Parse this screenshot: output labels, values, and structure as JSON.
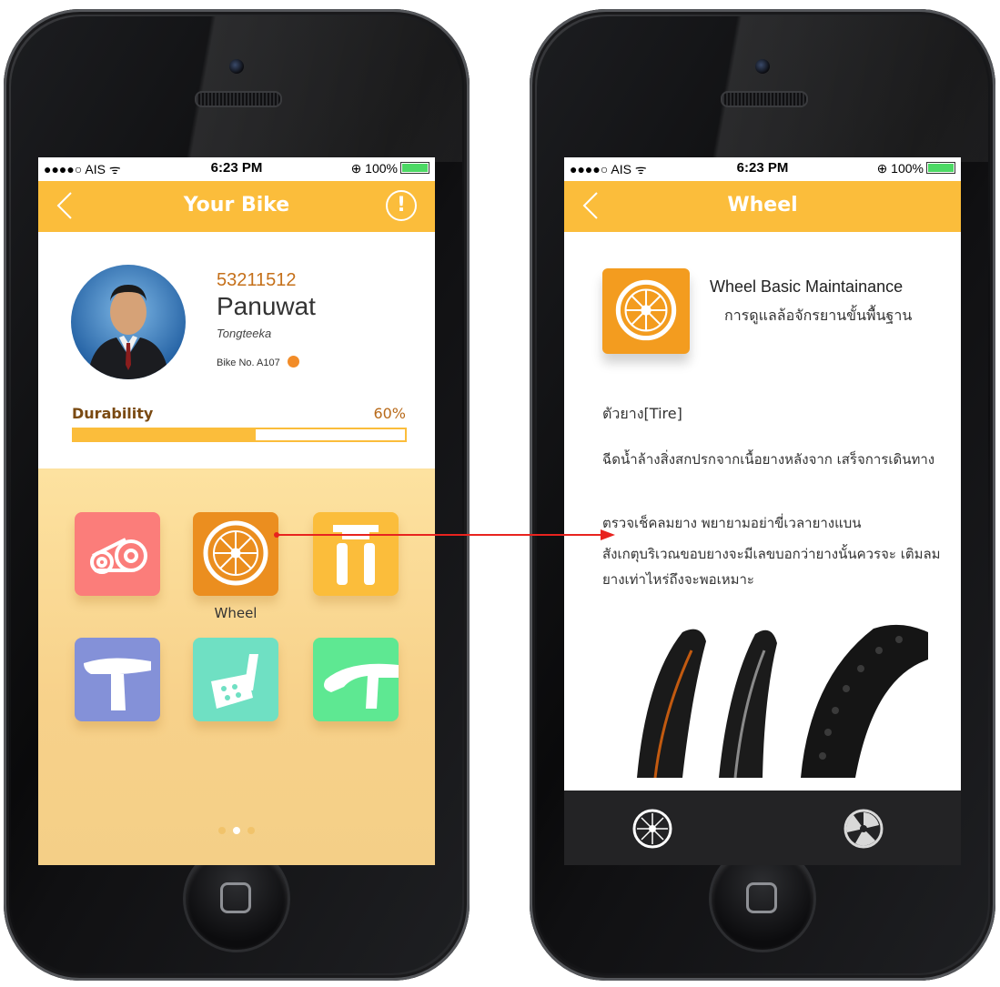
{
  "left_screen": {
    "status": {
      "carrier": "●●●●○ AIS ᯤ",
      "time": "6:23 PM",
      "battery": "⊕ 100%"
    },
    "nav": {
      "title": "Your Bike",
      "info": "!"
    },
    "profile": {
      "id": "53211512",
      "name": "Panuwat",
      "surname": "Tongteeka",
      "bike_no": "Bike No. A107"
    },
    "durability": {
      "label": "Durability",
      "value": "60%",
      "fraction": 0.55
    },
    "tiles": [
      {
        "name": "chain-icon",
        "color": "#fb7d7a"
      },
      {
        "name": "wheel-icon",
        "color": "#eb8e1f",
        "label": "Wheel"
      },
      {
        "name": "brake-icon",
        "color": "#fbbd3b"
      },
      {
        "name": "seat-icon",
        "color": "#8491d8"
      },
      {
        "name": "pedal-icon",
        "color": "#6fe0c3"
      },
      {
        "name": "handlebar-icon",
        "color": "#5ee892"
      }
    ],
    "pager": {
      "count": 3,
      "active": 1
    }
  },
  "right_screen": {
    "status": {
      "carrier": "●●●●○ AIS ᯤ",
      "time": "6:23 PM",
      "battery": "⊕ 100%"
    },
    "nav": {
      "title": "Wheel"
    },
    "header": {
      "title": "Wheel Basic Maintainance",
      "subtitle": "การดูแลล้อจักรยานขั้นพื้นฐาน"
    },
    "section": "ตัวยาง[Tire]",
    "paragraphs": [
      "ฉีดน้ำล้างสิ่งสกปรกจากเนื้อยางหลังจาก เสร็จการเดินทาง",
      "ตรวจเช็คลมยาง พยายามอย่าขี่เวลายางแบน",
      "สังเกตุบริเวณขอบยางจะมีเลขบอกว่ายางนั้นควรจะ เติมลมยางเท่าไหร่ถึงจะพอเหมาะ"
    ],
    "tabbar": [
      "wheel-tab-icon",
      "wheel-alt-tab-icon"
    ]
  },
  "colors": {
    "accent": "#fbbd3b",
    "dark": "#232325",
    "arrow": "#e8231f"
  }
}
